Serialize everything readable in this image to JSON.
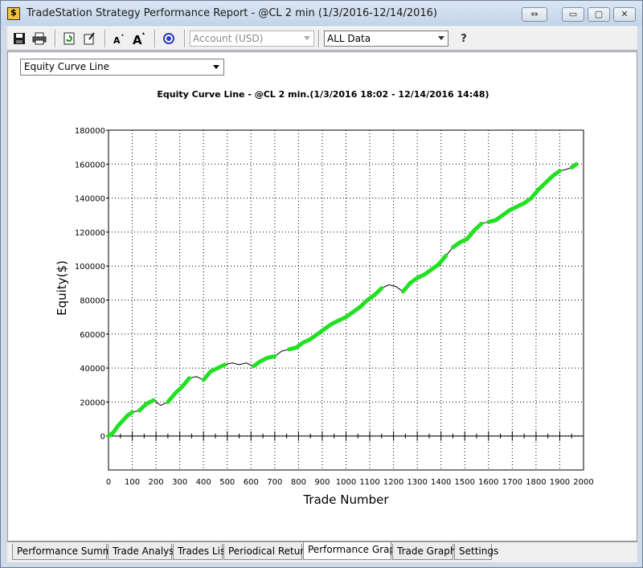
{
  "window": {
    "title": "TradeStation Strategy Performance Report - @CL 2 min (1/3/2016-12/14/2016)",
    "buttons": {
      "restore_glyph": "⇔",
      "minimize_glyph": "▭",
      "maximize_glyph": "▢",
      "close_glyph": "✕"
    }
  },
  "toolbar": {
    "account_combo": "Account (USD)",
    "data_combo": "ALL Data",
    "help_glyph": "?"
  },
  "graph_selector": {
    "value": "Equity Curve Line"
  },
  "chart_data": {
    "type": "line",
    "title": "Equity Curve Line - @CL 2 min.(1/3/2016 18:02 - 12/14/2016 14:48)",
    "xlabel": "Trade Number",
    "ylabel": "Equity($)",
    "xlim": [
      0,
      2000
    ],
    "ylim": [
      -20000,
      180000
    ],
    "xticks": [
      0,
      100,
      200,
      300,
      400,
      500,
      600,
      700,
      800,
      900,
      1000,
      1100,
      1200,
      1300,
      1400,
      1500,
      1600,
      1700,
      1800,
      1900,
      2000
    ],
    "yticks": [
      0,
      20000,
      40000,
      60000,
      80000,
      100000,
      120000,
      140000,
      160000,
      180000
    ],
    "grid": true,
    "line_color": "#000000",
    "highlight_color": "#22e022",
    "x": [
      0,
      20,
      40,
      60,
      80,
      100,
      130,
      160,
      190,
      220,
      250,
      280,
      310,
      340,
      370,
      400,
      430,
      460,
      490,
      520,
      550,
      580,
      610,
      640,
      670,
      700,
      730,
      760,
      790,
      820,
      850,
      880,
      910,
      940,
      970,
      1000,
      1030,
      1060,
      1090,
      1120,
      1150,
      1180,
      1210,
      1240,
      1270,
      1300,
      1330,
      1360,
      1390,
      1420,
      1450,
      1480,
      1510,
      1540,
      1570,
      1600,
      1630,
      1660,
      1690,
      1720,
      1750,
      1780,
      1810,
      1840,
      1870,
      1900,
      1930,
      1950,
      1970
    ],
    "y": [
      0,
      2000,
      6000,
      9000,
      12000,
      14000,
      15000,
      19000,
      21000,
      18000,
      20000,
      25000,
      29000,
      34000,
      35000,
      33000,
      38000,
      40000,
      42000,
      43000,
      42000,
      43000,
      41000,
      44000,
      46000,
      47000,
      50000,
      51000,
      52000,
      55000,
      57000,
      60000,
      63000,
      66000,
      68000,
      70000,
      73000,
      76000,
      80000,
      83000,
      87000,
      89000,
      88000,
      85000,
      90000,
      93000,
      95000,
      98000,
      101000,
      106000,
      111000,
      114000,
      116000,
      121000,
      125000,
      126000,
      127000,
      130000,
      133000,
      135000,
      137000,
      140000,
      145000,
      149000,
      153000,
      156000,
      157000,
      158000,
      160000
    ],
    "green": [
      true,
      true,
      true,
      true,
      true,
      true,
      false,
      true,
      true,
      false,
      false,
      true,
      true,
      true,
      false,
      false,
      true,
      true,
      true,
      false,
      false,
      false,
      false,
      true,
      true,
      true,
      false,
      false,
      true,
      true,
      true,
      true,
      true,
      true,
      true,
      true,
      true,
      true,
      true,
      true,
      true,
      false,
      false,
      false,
      true,
      true,
      true,
      true,
      true,
      true,
      false,
      true,
      true,
      true,
      true,
      false,
      true,
      true,
      true,
      true,
      true,
      true,
      true,
      true,
      true,
      true,
      false,
      false,
      true
    ]
  },
  "tabs": [
    {
      "label": "Performance Summary"
    },
    {
      "label": "Trade Analysis"
    },
    {
      "label": "Trades List"
    },
    {
      "label": "Periodical Returns"
    },
    {
      "label": "Performance Graphs"
    },
    {
      "label": "Trade Graphs"
    },
    {
      "label": "Settings"
    }
  ]
}
